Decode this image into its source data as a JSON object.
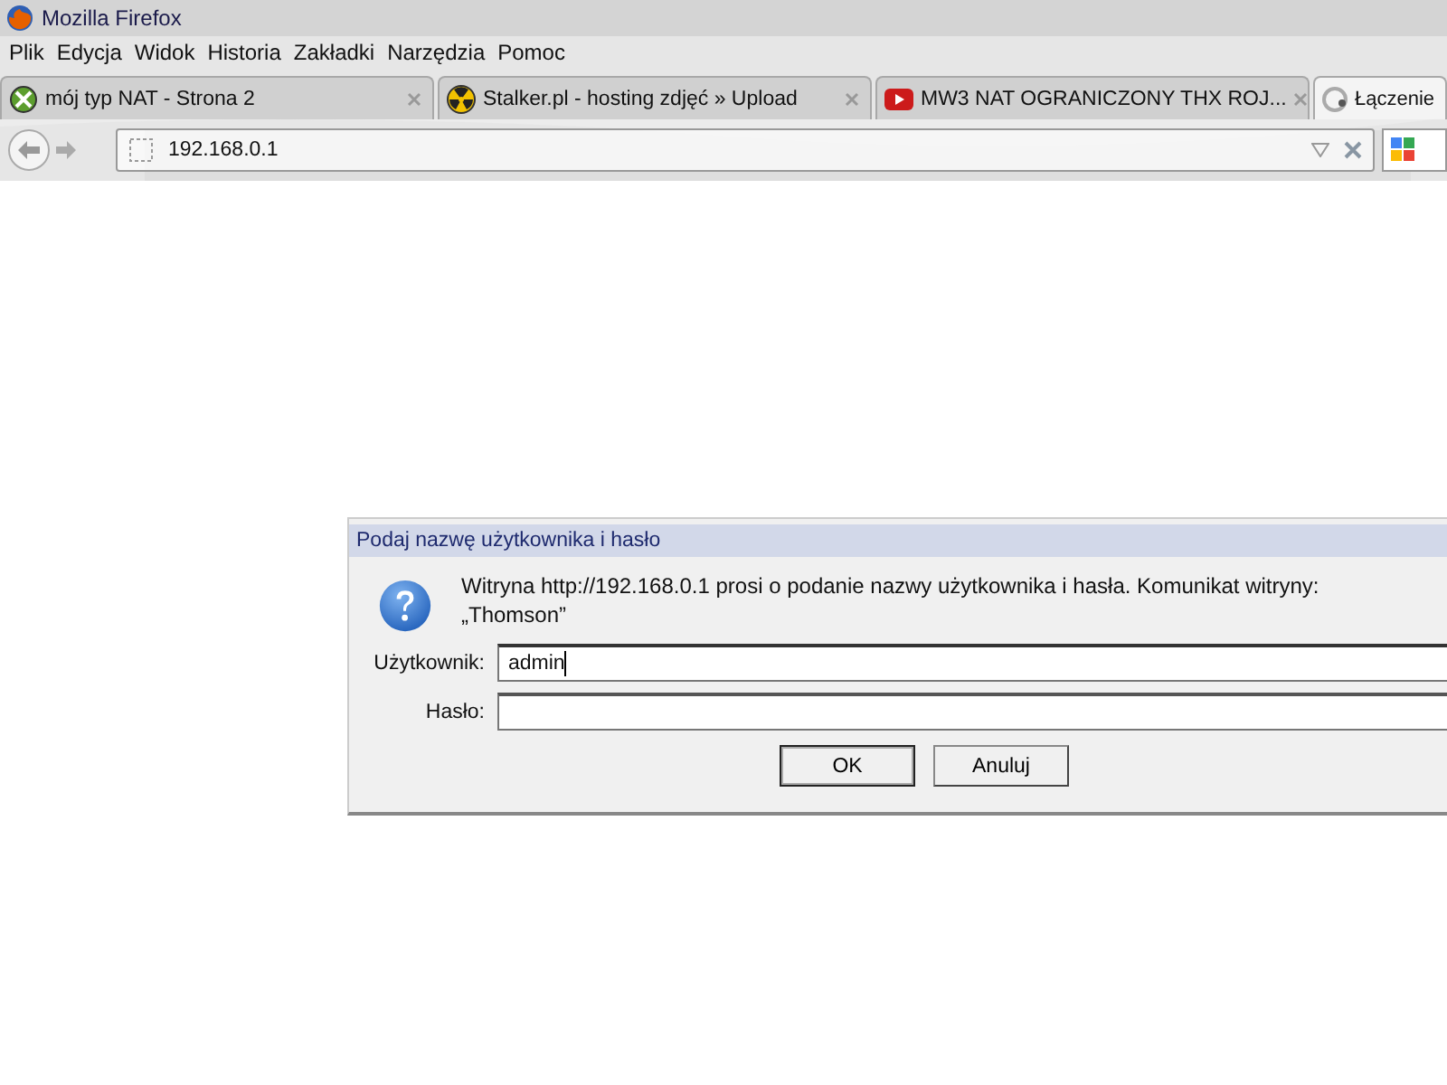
{
  "window": {
    "title": "Mozilla Firefox"
  },
  "menu": [
    "Plik",
    "Edycja",
    "Widok",
    "Historia",
    "Zakładki",
    "Narzędzia",
    "Pomoc"
  ],
  "tabs": [
    {
      "kind": "xbox",
      "label": "mój typ NAT - Strona 2",
      "selected": false
    },
    {
      "kind": "hazard",
      "label": "Stalker.pl - hosting zdjęć » Upload",
      "selected": false
    },
    {
      "kind": "video",
      "label": "MW3 NAT OGRANICZONY THX ROJ...",
      "selected": false
    },
    {
      "kind": "loading",
      "label": "Łączenie",
      "selected": true
    }
  ],
  "address_bar": {
    "value": "192.168.0.1"
  },
  "dialog": {
    "title": "Podaj nazwę użytkownika i hasło",
    "message": "Witryna http://192.168.0.1 prosi o podanie nazwy użytkownika i hasła. Komunikat witryny: „Thomson”",
    "fields": [
      {
        "label": "Użytkownik:",
        "value": "admin",
        "focused": true
      },
      {
        "label": "Hasło:",
        "focused": false
      }
    ],
    "buttons": [
      "OK",
      "Anuluj"
    ]
  }
}
